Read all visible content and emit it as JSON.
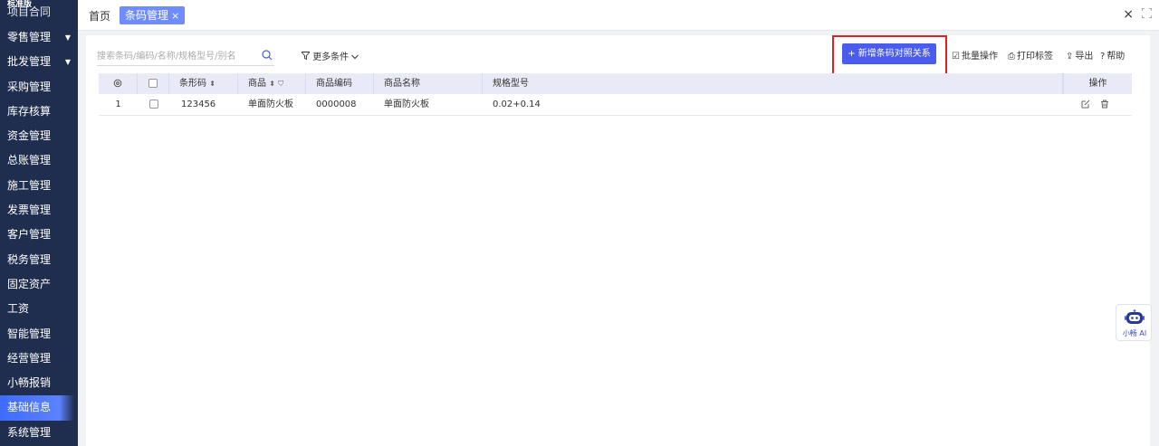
{
  "sidebar": {
    "brand": "标准版",
    "partial_item": "项目合同",
    "items": [
      {
        "label": "零售管理",
        "caret": "▼"
      },
      {
        "label": "批发管理",
        "caret": "▼"
      },
      {
        "label": "采购管理",
        "caret": ""
      },
      {
        "label": "库存核算",
        "caret": ""
      },
      {
        "label": "资金管理",
        "caret": ""
      },
      {
        "label": "总账管理",
        "caret": ""
      },
      {
        "label": "施工管理",
        "caret": ""
      },
      {
        "label": "发票管理",
        "caret": ""
      },
      {
        "label": "客户管理",
        "caret": ""
      },
      {
        "label": "税务管理",
        "caret": ""
      },
      {
        "label": "固定资产",
        "caret": ""
      },
      {
        "label": "工资",
        "caret": ""
      },
      {
        "label": "智能管理",
        "caret": ""
      },
      {
        "label": "经营管理",
        "caret": ""
      },
      {
        "label": "小畅报销",
        "caret": ""
      },
      {
        "label": "基础信息",
        "caret": ""
      },
      {
        "label": "系统管理",
        "caret": ""
      }
    ],
    "active_index": 15
  },
  "tabs": {
    "home": "首页",
    "active": "条码管理",
    "active_close": "×"
  },
  "top_controls": {
    "close": "×",
    "fullscreen": "⛶"
  },
  "search": {
    "placeholder": "搜索条码/编码/名称/规格型号/别名"
  },
  "filters": {
    "more_conditions": "更多条件"
  },
  "toolbar": {
    "add_label": "+ 新增条码对照关系",
    "batch_label": "批量操作",
    "print_label": "打印标签",
    "export_label": "导出",
    "help_label": "帮助"
  },
  "table": {
    "headers": {
      "settings": "⚙",
      "barcode": "条形码",
      "product": "商品",
      "code": "商品编码",
      "name": "商品名称",
      "spec": "规格型号",
      "ops": "操作"
    },
    "rows": [
      {
        "index": "1",
        "barcode": "123456",
        "product": "单面防火板",
        "code": "0000008",
        "name": "单面防火板",
        "spec": "0.02+0.14"
      }
    ]
  },
  "assistant": {
    "label": "小畅 AI"
  },
  "colors": {
    "sidebar_bg": "#1f2d4e",
    "accent": "#4a5cf0",
    "highlight_box": "#e02020",
    "table_header_bg": "#e8ebf7"
  }
}
